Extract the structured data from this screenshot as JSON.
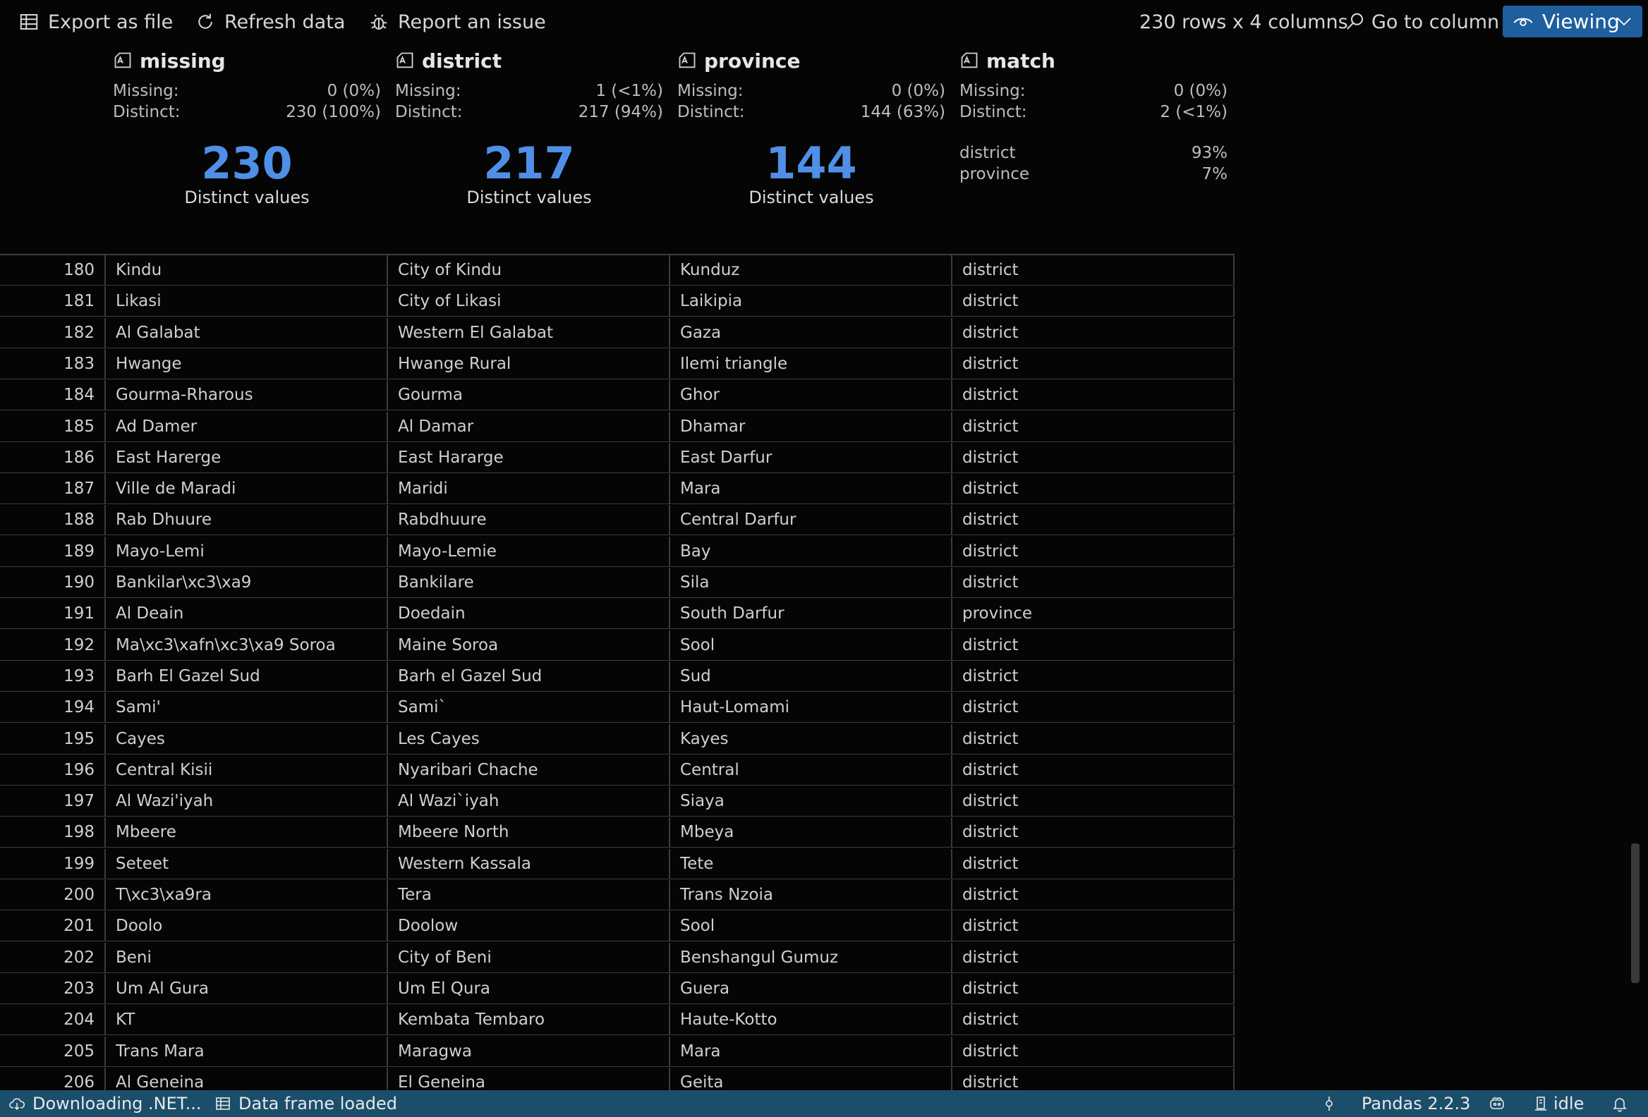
{
  "toolbar": {
    "export_label": "Export as file",
    "refresh_label": "Refresh data",
    "report_label": "Report an issue",
    "shape_text": "230 rows x 4 columns",
    "goto_label": "Go to column",
    "viewing_label": "Viewing"
  },
  "summary": [
    {
      "name": "missing",
      "missing_label": "Missing:",
      "missing_value": "0 (0%)",
      "distinct_label": "Distinct:",
      "distinct_value": "230 (100%)",
      "big_number": "230",
      "big_label": "Distinct values"
    },
    {
      "name": "district",
      "missing_label": "Missing:",
      "missing_value": "1 (<1%)",
      "distinct_label": "Distinct:",
      "distinct_value": "217 (94%)",
      "big_number": "217",
      "big_label": "Distinct values"
    },
    {
      "name": "province",
      "missing_label": "Missing:",
      "missing_value": "0 (0%)",
      "distinct_label": "Distinct:",
      "distinct_value": "144 (63%)",
      "big_number": "144",
      "big_label": "Distinct values"
    },
    {
      "name": "match",
      "missing_label": "Missing:",
      "missing_value": "0 (0%)",
      "distinct_label": "Distinct:",
      "distinct_value": "2 (<1%)",
      "breakdown": [
        {
          "label": "district",
          "value": "93%"
        },
        {
          "label": "province",
          "value": "7%"
        }
      ]
    }
  ],
  "rows": [
    [
      "180",
      "Kindu",
      "City of Kindu",
      "Kunduz",
      "district"
    ],
    [
      "181",
      "Likasi",
      "City of Likasi",
      "Laikipia",
      "district"
    ],
    [
      "182",
      "Al Galabat",
      "Western El Galabat",
      "Gaza",
      "district"
    ],
    [
      "183",
      "Hwange",
      "Hwange Rural",
      "Ilemi triangle",
      "district"
    ],
    [
      "184",
      "Gourma-Rharous",
      "Gourma",
      "Ghor",
      "district"
    ],
    [
      "185",
      "Ad Damer",
      "Al Damar",
      "Dhamar",
      "district"
    ],
    [
      "186",
      "East Harerge",
      "East Hararge",
      "East Darfur",
      "district"
    ],
    [
      "187",
      "Ville de Maradi",
      "Maridi",
      "Mara",
      "district"
    ],
    [
      "188",
      "Rab Dhuure",
      "Rabdhuure",
      "Central Darfur",
      "district"
    ],
    [
      "189",
      "Mayo-Lemi",
      "Mayo-Lemie",
      "Bay",
      "district"
    ],
    [
      "190",
      "Bankilar\\xc3\\xa9",
      "Bankilare",
      "Sila",
      "district"
    ],
    [
      "191",
      "Al Deain",
      "Doedain",
      "South Darfur",
      "province"
    ],
    [
      "192",
      "Ma\\xc3\\xafn\\xc3\\xa9 Soroa",
      "Maine Soroa",
      "Sool",
      "district"
    ],
    [
      "193",
      "Barh El Gazel Sud",
      "Barh el Gazel Sud",
      "Sud",
      "district"
    ],
    [
      "194",
      "Sami'",
      "Sami`",
      "Haut-Lomami",
      "district"
    ],
    [
      "195",
      "Cayes",
      "Les Cayes",
      "Kayes",
      "district"
    ],
    [
      "196",
      "Central Kisii",
      "Nyaribari Chache",
      "Central",
      "district"
    ],
    [
      "197",
      "Al Wazi'iyah",
      "Al Wazi`iyah",
      "Siaya",
      "district"
    ],
    [
      "198",
      "Mbeere",
      "Mbeere North",
      "Mbeya",
      "district"
    ],
    [
      "199",
      "Seteet",
      "Western Kassala",
      "Tete",
      "district"
    ],
    [
      "200",
      "T\\xc3\\xa9ra",
      "Tera",
      "Trans Nzoia",
      "district"
    ],
    [
      "201",
      "Doolo",
      "Doolow",
      "Sool",
      "district"
    ],
    [
      "202",
      "Beni",
      "City of Beni",
      "Benshangul Gumuz",
      "district"
    ],
    [
      "203",
      "Um Al Gura",
      "Um El Qura",
      "Guera",
      "district"
    ],
    [
      "204",
      "KT",
      "Kembata Tembaro",
      "Haute-Kotto",
      "district"
    ],
    [
      "205",
      "Trans Mara",
      "Maragwa",
      "Mara",
      "district"
    ],
    [
      "206",
      "Al Geneina",
      "El Geneina",
      "Geita",
      "district"
    ]
  ],
  "statusbar": {
    "downloading": "Downloading .NET...",
    "loaded": "Data frame loaded",
    "pandas": "Pandas 2.2.3",
    "state": "idle"
  }
}
